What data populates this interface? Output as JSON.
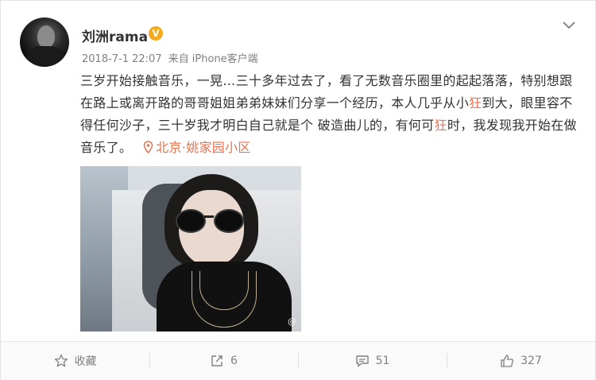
{
  "post": {
    "username": "刘洲rama",
    "verified_badge": "V",
    "timestamp": "2018-7-1 22:07",
    "source_prefix": "来自",
    "source": "iPhone客户端",
    "text_part1": "三岁开始接触音乐，一晃…三十多年过去了，看了无数音乐圈里的起起落落，特别想跟在路上或离开路的哥哥姐姐弟弟妹妹们分享一个经历，本人几乎从小",
    "highlight1": "狂",
    "text_part2": "到大，眼里容不得任何沙子，三十岁我才明白自己就是个 破造曲儿的，有何可",
    "highlight2": "狂",
    "text_part3": "时，我发现我开始在做音乐了。",
    "location": "北京·姚家园小区",
    "image_watermark": "@"
  },
  "actions": {
    "favorite_label": "收藏",
    "repost_count": "6",
    "comment_count": "51",
    "like_count": "327"
  },
  "colors": {
    "accent": "#eb7350",
    "verified": "#f4a91e",
    "meta": "#808080"
  },
  "icons": {
    "menu": "chevron-down-icon",
    "verified": "verified-badge-icon",
    "location": "location-pin-icon",
    "favorite": "star-icon",
    "repost": "repost-icon",
    "comment": "comment-icon",
    "like": "thumbs-up-icon"
  }
}
